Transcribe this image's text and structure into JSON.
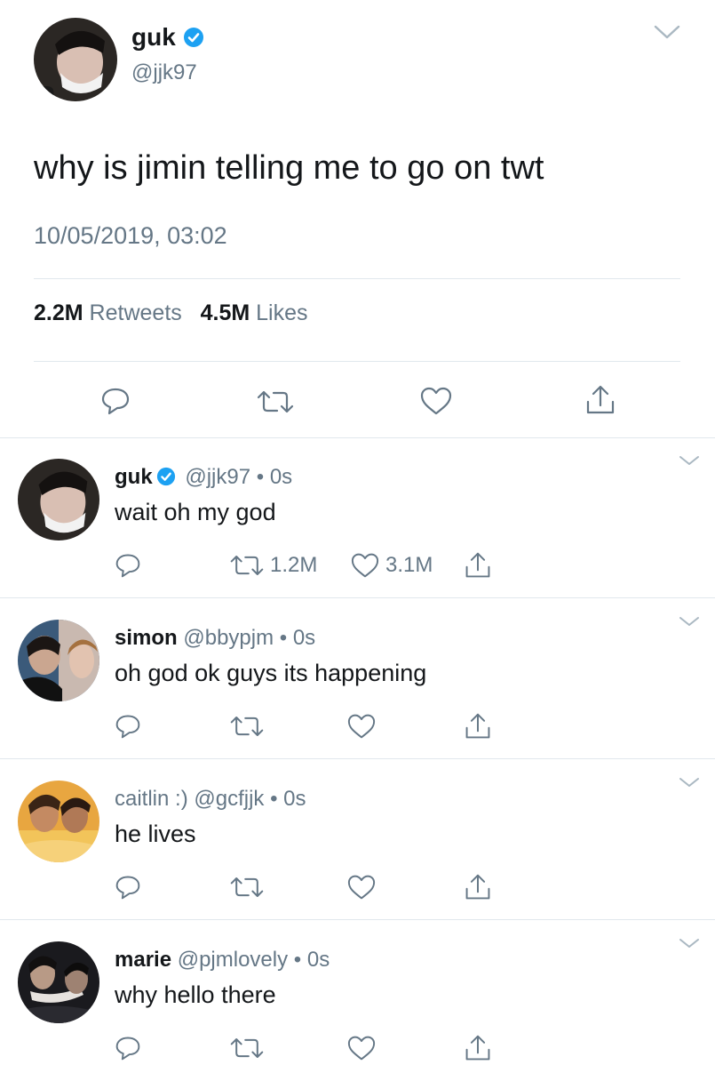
{
  "tweet": {
    "name": "guk",
    "handle": "@jjk97",
    "text": "why is jimin telling me to go on twt",
    "timestamp": "10/05/2019, 03:02",
    "retweets_count": "2.2M",
    "retweets_label": "Retweets",
    "likes_count": "4.5M",
    "likes_label": "Likes"
  },
  "colors": {
    "verified": "#1da1f2",
    "muted": "#657786",
    "divider": "#e1e8ed"
  },
  "icons": [
    "chevron-down-icon",
    "verified-badge-icon",
    "reply-icon",
    "retweet-icon",
    "like-icon",
    "share-icon"
  ],
  "replies": [
    {
      "name": "guk",
      "verified": true,
      "handle": "@jjk97",
      "time": "• 0s",
      "text": "wait oh my god",
      "retweets": "1.2M",
      "likes": "3.1M"
    },
    {
      "name": "simon",
      "verified": false,
      "handle": "@bbypjm",
      "time": "• 0s",
      "text": "oh god ok guys its happening",
      "retweets": "",
      "likes": ""
    },
    {
      "name": "caitlin :)",
      "verified": false,
      "handle": "@gcfjjk",
      "time": "• 0s",
      "text": "he lives",
      "retweets": "",
      "likes": ""
    },
    {
      "name": "marie",
      "verified": false,
      "handle": "@pjmlovely",
      "time": "• 0s",
      "text": "why hello there",
      "retweets": "",
      "likes": ""
    }
  ]
}
